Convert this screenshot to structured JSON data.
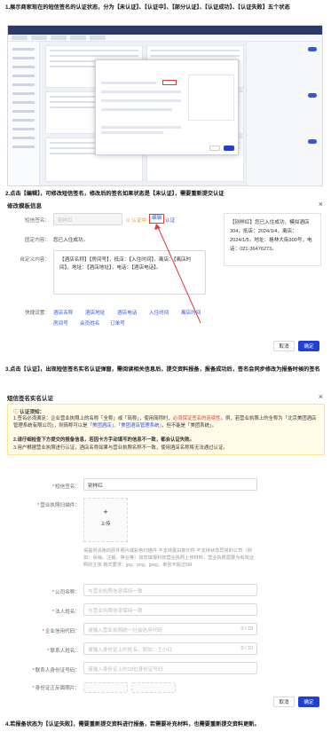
{
  "steps": {
    "step1": "1.展示商家现在的短信签名的认证状态，分为【未认证】、【认证中】、【部分认证】、【认证成功】、【认证失败】五个状态",
    "step2": "2.点击【编辑】，可修改短信签名，修改后的签名如果状态是【未认证】，需要重新提交认证",
    "step3": "3.点击【认证】，出现短信签名实名认证弹窗，需阅读相关信息后，提交资料报备，报备成功后，签名会同步修改为报备时候的签名",
    "step4": "4.若报备状态为【认证失败】，需要重新提交资料进行报备，若需要补充材料，也需要重新提交资料更新。"
  },
  "edit_dialog": {
    "title": "修改模板信息",
    "close": "×",
    "sign_label": "短信签名：",
    "sign_value": "别样红",
    "status": "⊙ 认证中",
    "edit_link": "编辑",
    "auth_link": "认证",
    "fixed_label": "固定内容：",
    "fixed_value": "您已入住成功。",
    "custom_label": "自定义内容：",
    "custom_value": "【酒店名称】【房间号】，抵店：【入住时间】，离店：【离店时间】，地址：【酒店地址】，电话：【酒店电话】。",
    "quick_label": "快捷设置：",
    "quick_items": [
      "酒店名称",
      "酒店地址",
      "酒店电话",
      "入住时间",
      "离店时间",
      "房间号",
      "会员姓名",
      "订单号"
    ],
    "preview": "【别样红】您已入住成功，模拟酒店304，抵店：2024/1/4，离店：2024/1/5，地址：格林大街300号，电话：021-36476273。",
    "cancel": "取消",
    "confirm": "确定"
  },
  "auth_dialog": {
    "title": "短信签名实名认证",
    "close": "×",
    "notice_title": "认证须知：",
    "notice_1a": "1.签名必须满足：企业营业执照上的名称「全称」或「简称」，使用简称时，",
    "notice_1b": "必须保证签名的连续性",
    "notice_1c": "。例，若营业执照上的全称为「北京美团酒店管理系统有限公司」，则简称可以是",
    "notice_1d": "「美团酒店」、「美团酒店管理系统」",
    "notice_1e": "，但不能是「美团系统」。",
    "notice_2": "2.请仔细检查下方提交的报备信息，若因卡方手动填写的信息不一致，都会认证失败。",
    "notice_3": "3.用户根据营业执照进行认证，酒店名称如果与营业执照名称不一致，使用酒店名称将无法通过认证。",
    "sign_label": "短信签名：",
    "sign_value": "别样红",
    "license_label": "营业执照扫描件：",
    "upload_label": "上传",
    "hint": "请提供清晰的原件照片或彩色扫描件 不支持黑白复印件 不支持状态异常的公司（例如：吊销、注销、停业等）如您填报科技营业执照上传材料，营业执照需要为有效证照的主体 格式要求：jpg、png、jpeg，单张不超过5M",
    "company_label": "公司名称：",
    "company_placeholder": "与营业执照信息保持一致",
    "legal_label": "法人姓名：",
    "legal_placeholder": "与营业执照信息保持一致",
    "credit_label": "企业信用代码：",
    "credit_placeholder": "请输入营业执照统一社会信用代码",
    "credit_count": "0 / 18",
    "contact_label": "联系人姓名：",
    "contact_placeholder": "请输入身份证上的姓名，例如：王小红",
    "contact_count": "0 / 10",
    "idno_label": "联系人身份证号码：",
    "idno_placeholder": "请输入身份证上的18位身份证号码",
    "idphoto_label": "身份证正反面照片：",
    "cancel": "取消",
    "confirm": "确定"
  },
  "colors": {
    "primary": "#1f3fd6",
    "link": "#2f54eb",
    "warning_bg": "#fffbe6",
    "red": "#e53935",
    "status_orange": "#fa8c16"
  }
}
